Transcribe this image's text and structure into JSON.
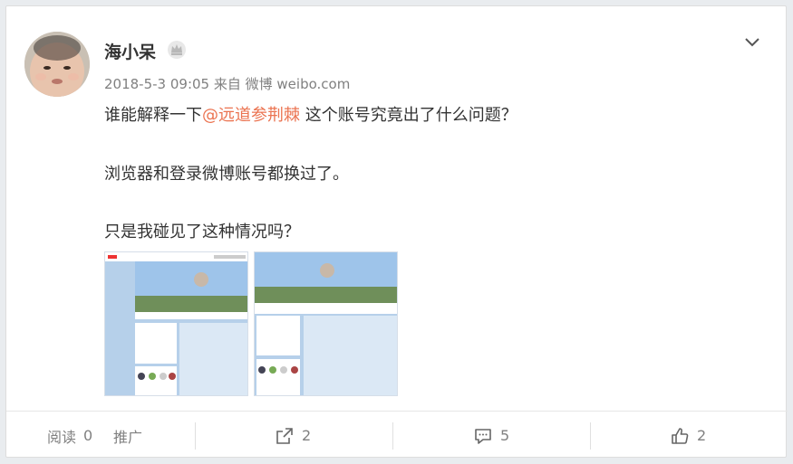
{
  "post": {
    "author": "海小呆",
    "time": "2018-5-3 09:05",
    "source": "来自 微博 weibo.com",
    "line1_before": "谁能解释一下",
    "mention": "@远道参荆棘",
    "line1_after": " 这个账号究竟出了什么问题？",
    "line2": "浏览器和登录微博账号都换过了。",
    "line3": "只是我碰见了这种情况吗？"
  },
  "footer": {
    "read_label": "阅读",
    "read_count": "0",
    "promote_label": "推广",
    "repost_count": "2",
    "comment_count": "5",
    "like_count": "2"
  },
  "icons": {
    "avatar": "baby-avatar",
    "badge": "vip-crown-icon",
    "more": "chevron-down-icon",
    "repost": "share-icon",
    "comment": "comment-icon",
    "like": "thumbs-up-icon"
  },
  "colors": {
    "mention": "#eb7350",
    "meta": "#808080",
    "text": "#333333"
  }
}
